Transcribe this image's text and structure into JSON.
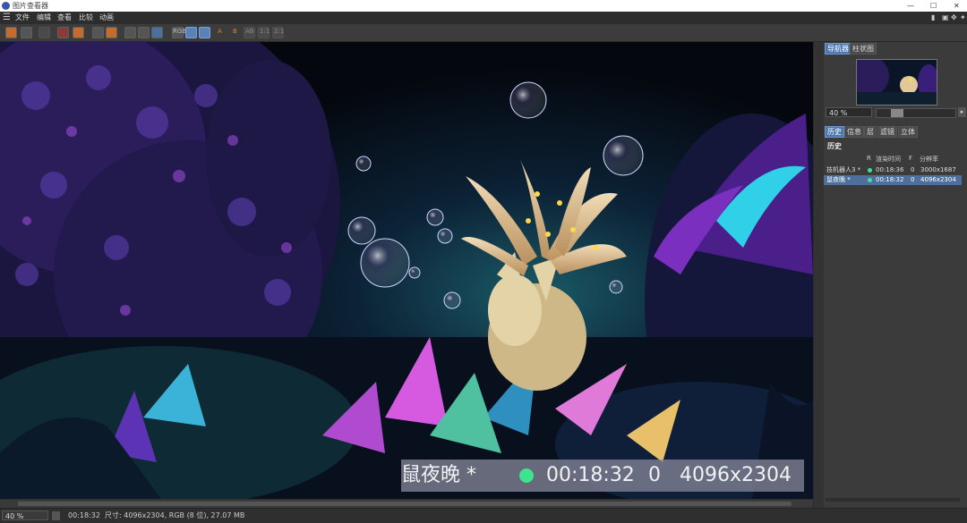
{
  "app": {
    "title": "图片查看器"
  },
  "window_controls": {
    "minimize": "—",
    "maximize": "☐",
    "close": "✕"
  },
  "menu": [
    "文件",
    "编辑",
    "查看",
    "比较",
    "动画"
  ],
  "toolbar": {
    "text_buttons": [
      "RGB",
      "A",
      "B",
      "AB",
      "1:1",
      "2:1"
    ]
  },
  "overlay": {
    "name": "鼠夜晚 *",
    "time": "00:18:32",
    "frame": "0",
    "resolution": "4096x2304",
    "status_color": "#3fe28d"
  },
  "panel": {
    "top_tabs": [
      "导航器",
      "柱状图"
    ],
    "zoom": "40 %",
    "zoom_level": 0.22,
    "info_tabs": [
      "历史",
      "信息",
      "层",
      "滤镜",
      "立体"
    ],
    "history_title": "历史",
    "history_headers": [
      "R",
      "渲染时间",
      "F",
      "分辨率"
    ],
    "history_rows": [
      {
        "name": "技机器人3 *",
        "time": "00:18:36",
        "frame": "0",
        "resolution": "3000x1687",
        "selected": false
      },
      {
        "name": "鼠夜晚 *",
        "time": "00:18:32",
        "frame": "0",
        "resolution": "4096x2304",
        "selected": true
      }
    ]
  },
  "statusbar": {
    "zoom": "40 %",
    "time": "00:18:32",
    "info": "尺寸: 4096x2304, RGB (8 位), 27.07 MB"
  },
  "icons": [
    "app-icon",
    "menu-icon",
    "open-icon",
    "save-icon",
    "compare-icon",
    "layout-icon",
    "zoom-icon"
  ]
}
